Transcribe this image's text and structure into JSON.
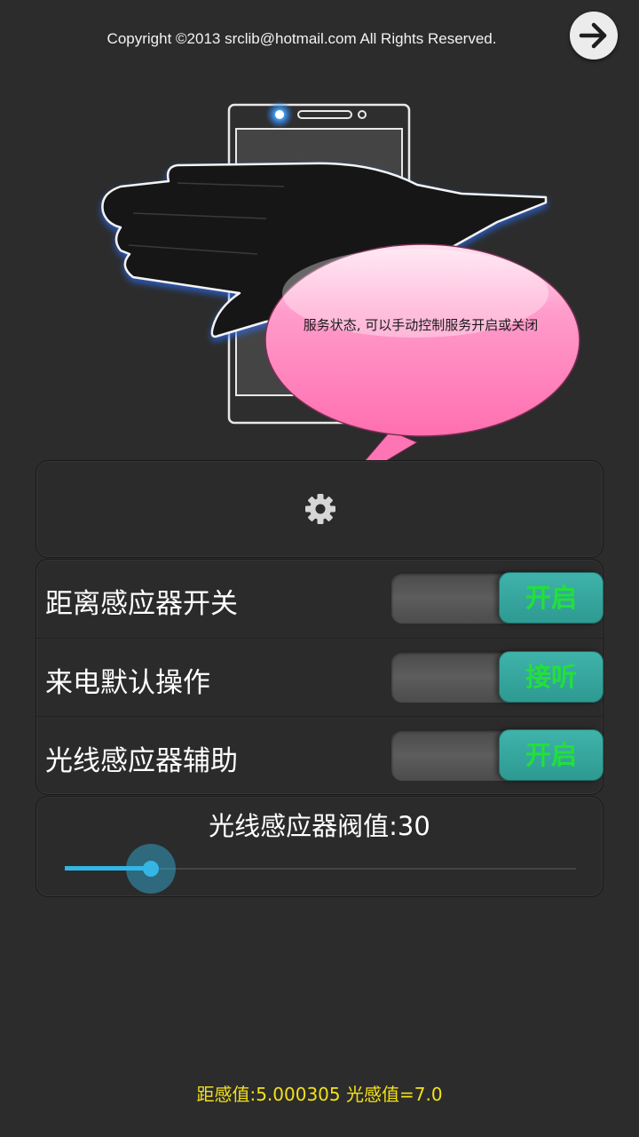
{
  "header": {
    "copyright": "Copyright ©2013 srclib@hotmail.com All Rights Reserved.",
    "next_icon": "arrow-right-icon"
  },
  "tooltip": {
    "text": "服务状态, 可以手动控制服务开启或关闭",
    "color": "#ff7ab8"
  },
  "settings": {
    "icon": "gear-icon"
  },
  "options": [
    {
      "label": "距离感应器开关",
      "toggle": "开启"
    },
    {
      "label": "来电默认操作",
      "toggle": "接听"
    },
    {
      "label": "光线感应器辅助",
      "toggle": "开启"
    }
  ],
  "threshold": {
    "label": "光线感应器阀值:30",
    "value": 30,
    "max": 500
  },
  "footer": {
    "readout": "距感值:5.000305 光感值=7.0"
  },
  "colors": {
    "accent": "#33b5e5",
    "toggle_on": "#3fb3aa",
    "toggle_text": "#22e03a",
    "readout": "#f2e01a"
  }
}
